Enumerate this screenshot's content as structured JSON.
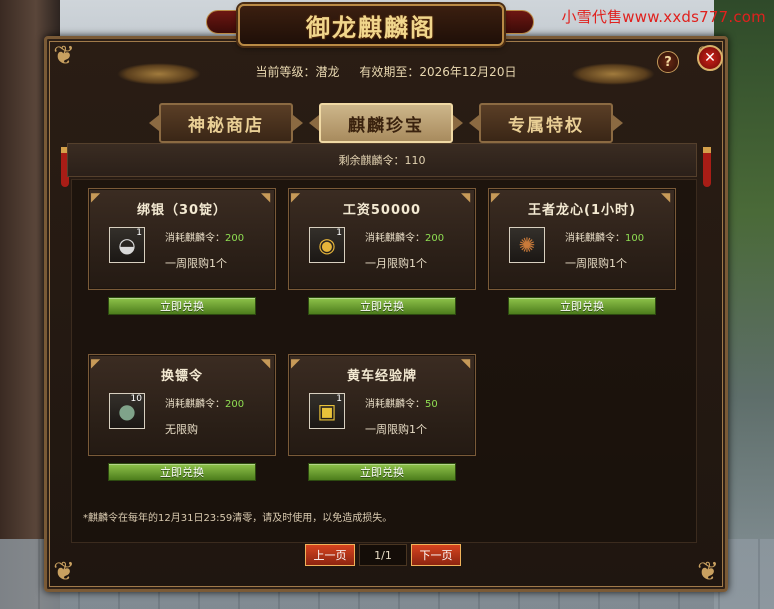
{
  "watermark": "小雪代售www.xxds777.com",
  "window": {
    "title": "御龙麒麟阁",
    "help_label": "?",
    "close_label": "✕"
  },
  "header": {
    "level_label": "当前等级：潜龙",
    "expiry_label": "有效期至：2026年12月20日"
  },
  "tabs": [
    {
      "label": "神秘商店",
      "active": false
    },
    {
      "label": "麒麟珍宝",
      "active": true
    },
    {
      "label": "专属特权",
      "active": false
    }
  ],
  "remaining": "剩余麒麟令：110",
  "items": [
    {
      "title": "绑银（30锭）",
      "icon": "silver-ingot-icon",
      "count": "1",
      "cost_label": "消耗麒麟令：",
      "cost": "200",
      "limit": "一周限购1个",
      "button": "立即兑换"
    },
    {
      "title": "工资50000",
      "icon": "gold-coins-icon",
      "count": "1",
      "cost_label": "消耗麒麟令：",
      "cost": "200",
      "limit": "一月限购1个",
      "button": "立即兑换"
    },
    {
      "title": "王者龙心(1小时)",
      "icon": "dragon-heart-icon",
      "count": "",
      "cost_label": "消耗麒麟令：",
      "cost": "100",
      "limit": "一周限购1个",
      "button": "立即兑换"
    },
    {
      "title": "换镖令",
      "icon": "escort-token-icon",
      "count": "10",
      "cost_label": "消耗麒麟令：",
      "cost": "200",
      "limit": "无限购",
      "button": "立即兑换"
    },
    {
      "title": "黄车经验牌",
      "icon": "gold-cart-icon",
      "count": "1",
      "cost_label": "消耗麒麟令：",
      "cost": "50",
      "limit": "一周限购1个",
      "button": "立即兑换"
    }
  ],
  "footnote": "*麒麟令在每年的12月31日23:59清零，请及时使用，以免造成损失。",
  "pager": {
    "prev": "上一页",
    "page": "1/1",
    "next": "下一页"
  }
}
